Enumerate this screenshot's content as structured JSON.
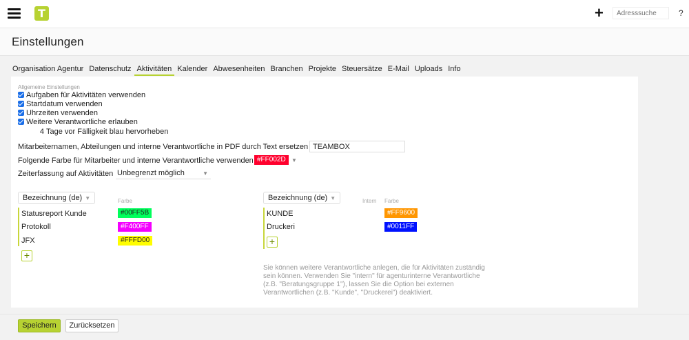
{
  "header": {
    "logo_letter": "T",
    "add_label": "+",
    "search_placeholder": "Adresssuche",
    "help_label": "?"
  },
  "page": {
    "title": "Einstellungen"
  },
  "tabs": [
    {
      "label": "Organisation Agentur"
    },
    {
      "label": "Datenschutz"
    },
    {
      "label": "Aktivitäten"
    },
    {
      "label": "Kalender"
    },
    {
      "label": "Abwesenheiten"
    },
    {
      "label": "Branchen"
    },
    {
      "label": "Projekte"
    },
    {
      "label": "Steuersätze"
    },
    {
      "label": "E-Mail"
    },
    {
      "label": "Uploads"
    },
    {
      "label": "Info"
    }
  ],
  "general": {
    "section_label": "Allgemeine Einstellungen",
    "checkboxes": [
      {
        "label": "Aufgaben für Aktivitäten verwenden",
        "checked": true
      },
      {
        "label": "Startdatum verwenden",
        "checked": true
      },
      {
        "label": "Uhrzeiten verwenden",
        "checked": true
      },
      {
        "label": "Weitere Verantwortliche erlauben",
        "checked": true
      }
    ],
    "days_value": "4",
    "days_label": "Tage vor Fälligkeit blau hervorheben",
    "pdf_label": "Mitarbeiternamen, Abteilungen und interne Verantwortliche in PDF durch Text ersetzen",
    "pdf_value": "TEAMBOX",
    "color_label": "Folgende Farbe für Mitarbeiter und interne Verantwortliche verwenden",
    "color_value": "#FF002D",
    "time_label": "Zeiterfassung auf Aktivitäten",
    "time_value": "Unbegrenzt möglich"
  },
  "left_list": {
    "dropdown": "Bezeichnung (de)",
    "color_header": "Farbe",
    "rows": [
      {
        "name": "Statusreport Kunde",
        "color": "#00FF5B",
        "text_color": "#222222"
      },
      {
        "name": "Protokoll",
        "color": "#F400FF",
        "text_color": "#ffffff"
      },
      {
        "name": "JFX",
        "color": "#FFFD00",
        "text_color": "#222222"
      }
    ]
  },
  "right_list": {
    "dropdown": "Bezeichnung (de)",
    "intern_header": "Intern",
    "color_header": "Farbe",
    "rows": [
      {
        "name": "KUNDE",
        "color": "#FF9600",
        "text_color": "#ffffff"
      },
      {
        "name": "Druckeri",
        "color": "#0011FF",
        "text_color": "#ffffff"
      }
    ],
    "help": "Sie können weitere Verantwortliche anlegen, die für Aktivitäten zuständig sein können. Verwenden Sie \"intern\" für agenturinterne Verantwortliche (z.B. \"Beratungsgruppe 1\"), lassen Sie die Option bei externen Verantwortlichen (z.B. \"Kunde\", \"Druckerei\") deaktiviert."
  },
  "add_label": "+",
  "footer": {
    "save_label": "Speichern",
    "reset_label": "Zurücksetzen"
  }
}
